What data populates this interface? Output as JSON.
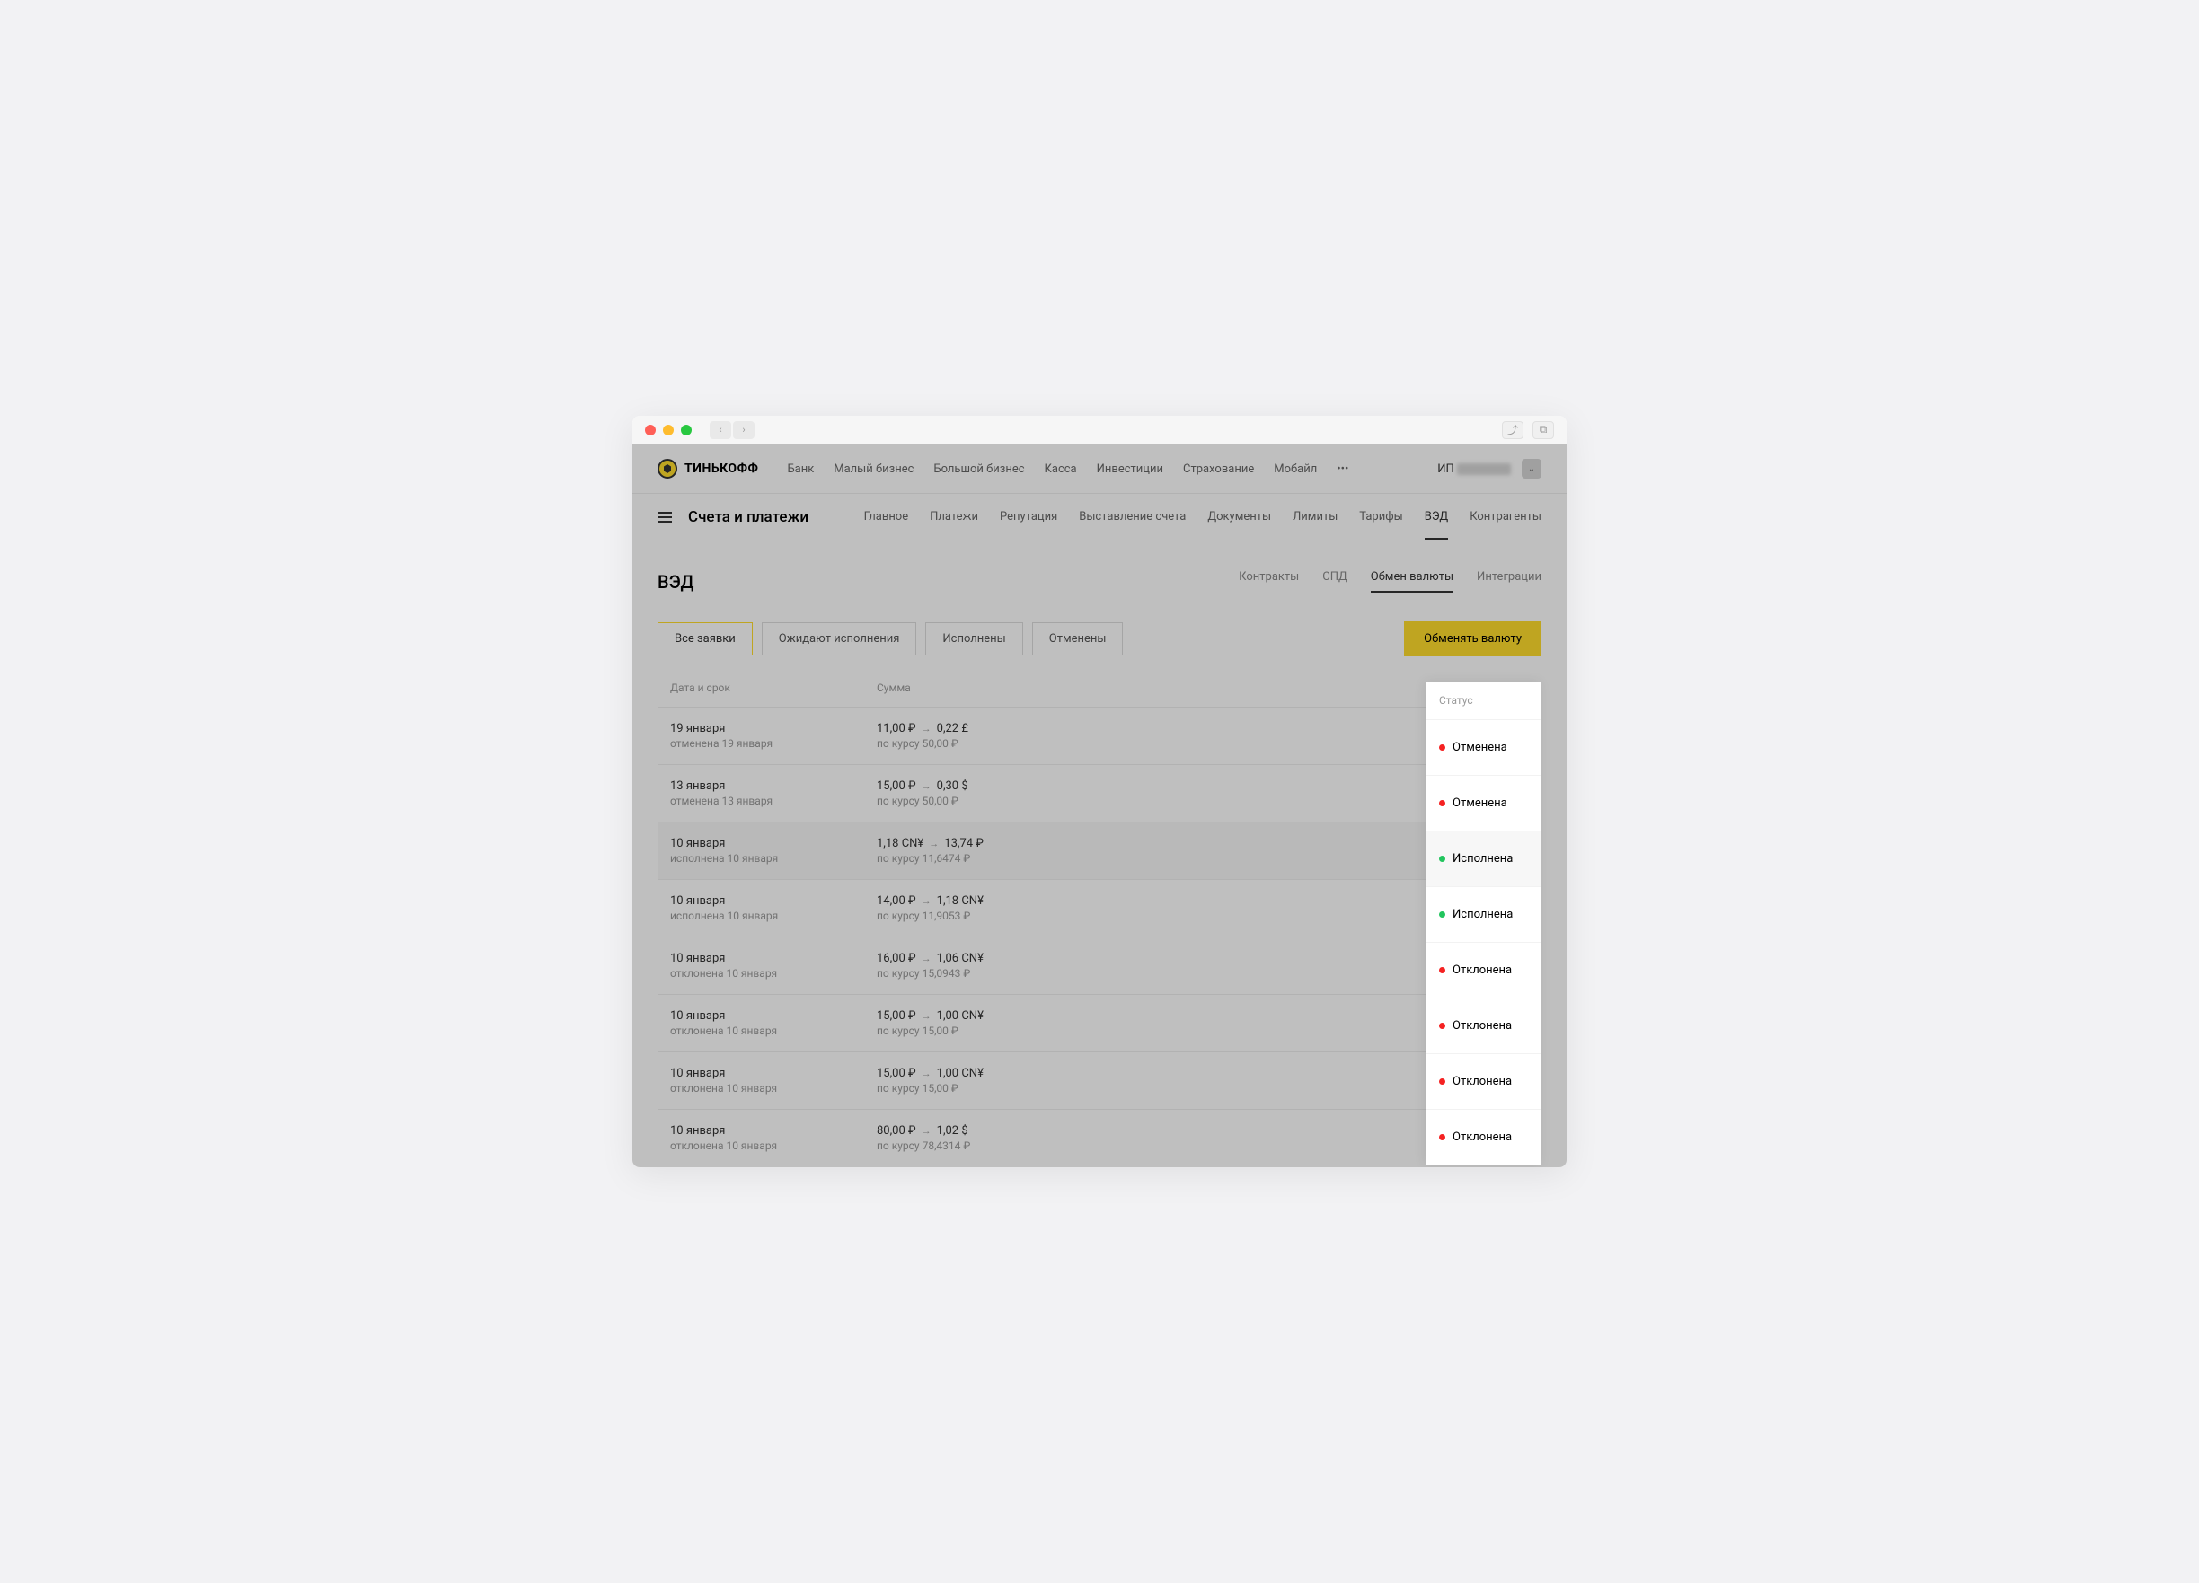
{
  "brand": "ТИНЬКОФФ",
  "topnav": [
    "Банк",
    "Малый бизнес",
    "Большой бизнес",
    "Касса",
    "Инвестиции",
    "Страхование",
    "Мобайл",
    "•••"
  ],
  "user_prefix": "ИП",
  "subnav_title": "Счета и платежи",
  "subnav": [
    "Главное",
    "Платежи",
    "Репутация",
    "Выставление счета",
    "Документы",
    "Лимиты",
    "Тарифы",
    "ВЭД",
    "Контрагенты"
  ],
  "subnav_active": "ВЭД",
  "page_title": "ВЭД",
  "page_tabs": [
    "Контракты",
    "СПД",
    "Обмен валюты",
    "Интеграции"
  ],
  "page_tabs_active": "Обмен валюты",
  "filters": [
    "Все заявки",
    "Ожидают исполнения",
    "Исполнены",
    "Отменены"
  ],
  "filters_active": "Все заявки",
  "primary_button": "Обменять валюту",
  "table_headers": {
    "date": "Дата и срок",
    "sum": "Сумма",
    "status": "Статус"
  },
  "rows": [
    {
      "date": "19 января",
      "sub": "отменена 19 января",
      "from": "11,00 ₽",
      "to": "0,22 £",
      "rate": "по курсу 50,00 ₽",
      "status": "Отменена",
      "color": "red"
    },
    {
      "date": "13 января",
      "sub": "отменена 13 января",
      "from": "15,00 ₽",
      "to": "0,30 $",
      "rate": "по курсу 50,00 ₽",
      "status": "Отменена",
      "color": "red"
    },
    {
      "date": "10 января",
      "sub": "исполнена 10 января",
      "from": "1,18 CN¥",
      "to": "13,74 ₽",
      "rate": "по курсу 11,6474 ₽",
      "status": "Исполнена",
      "color": "green",
      "highlight": true
    },
    {
      "date": "10 января",
      "sub": "исполнена 10 января",
      "from": "14,00 ₽",
      "to": "1,18 CN¥",
      "rate": "по курсу 11,9053 ₽",
      "status": "Исполнена",
      "color": "green"
    },
    {
      "date": "10 января",
      "sub": "отклонена 10 января",
      "from": "16,00 ₽",
      "to": "1,06 CN¥",
      "rate": "по курсу 15,0943 ₽",
      "status": "Отклонена",
      "color": "red"
    },
    {
      "date": "10 января",
      "sub": "отклонена 10 января",
      "from": "15,00 ₽",
      "to": "1,00 CN¥",
      "rate": "по курсу 15,00 ₽",
      "status": "Отклонена",
      "color": "red"
    },
    {
      "date": "10 января",
      "sub": "отклонена 10 января",
      "from": "15,00 ₽",
      "to": "1,00 CN¥",
      "rate": "по курсу 15,00 ₽",
      "status": "Отклонена",
      "color": "red"
    },
    {
      "date": "10 января",
      "sub": "отклонена 10 января",
      "from": "80,00 ₽",
      "to": "1,02 $",
      "rate": "по курсу 78,4314 ₽",
      "status": "Отклонена",
      "color": "red"
    }
  ]
}
